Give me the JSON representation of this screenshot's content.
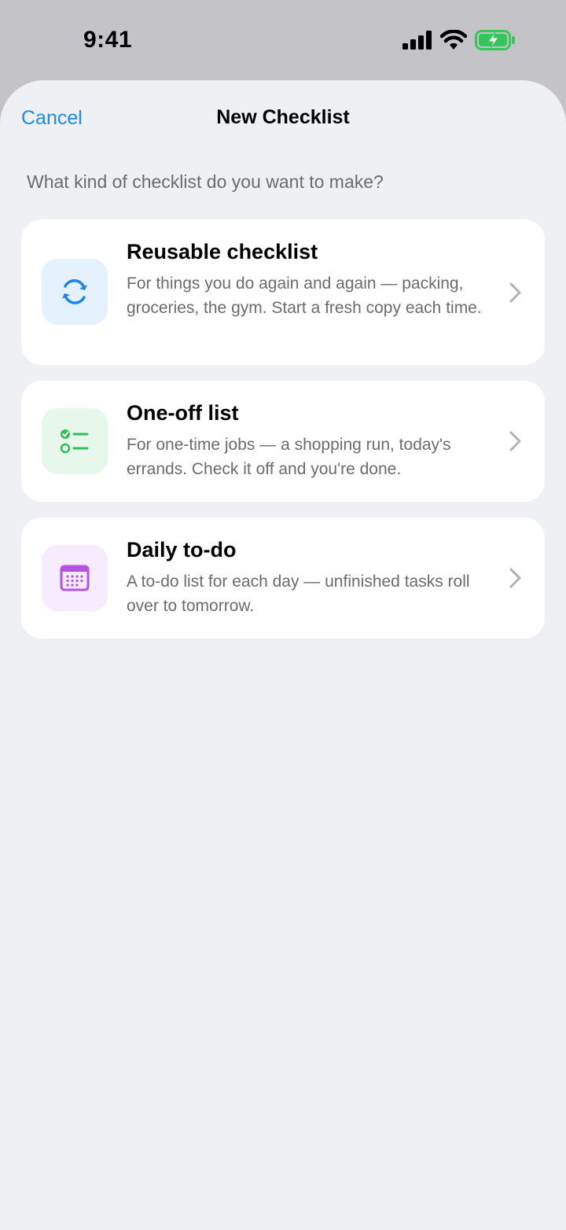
{
  "status": {
    "time": "9:41"
  },
  "nav": {
    "cancel_label": "Cancel",
    "title": "New Checklist"
  },
  "prompt": "What kind of checklist do you want to make?",
  "options": [
    {
      "title": "Reusable checklist",
      "description": "For things you do again and again — packing, groceries, the gym. Start a fresh copy each time.",
      "icon": "refresh-icon",
      "icon_color": "#1a84f0",
      "icon_bg": "#e6f1fe"
    },
    {
      "title": "One-off list",
      "description": "For one-time jobs — a shopping run, today's errands. Check it off and you're done.",
      "icon": "checklist-icon",
      "icon_color": "#2fbf58",
      "icon_bg": "#e8f7ec"
    },
    {
      "title": "Daily to-do",
      "description": "A to-do list for each day — unfinished tasks roll over to tomorrow.",
      "icon": "calendar-icon",
      "icon_color": "#b452e4",
      "icon_bg": "#f6ecfd"
    }
  ],
  "colors": {
    "accent": "#1a8cf0",
    "sheet_bg": "#eff0f4",
    "card_bg": "#ffffff",
    "battery": "#34c759"
  }
}
